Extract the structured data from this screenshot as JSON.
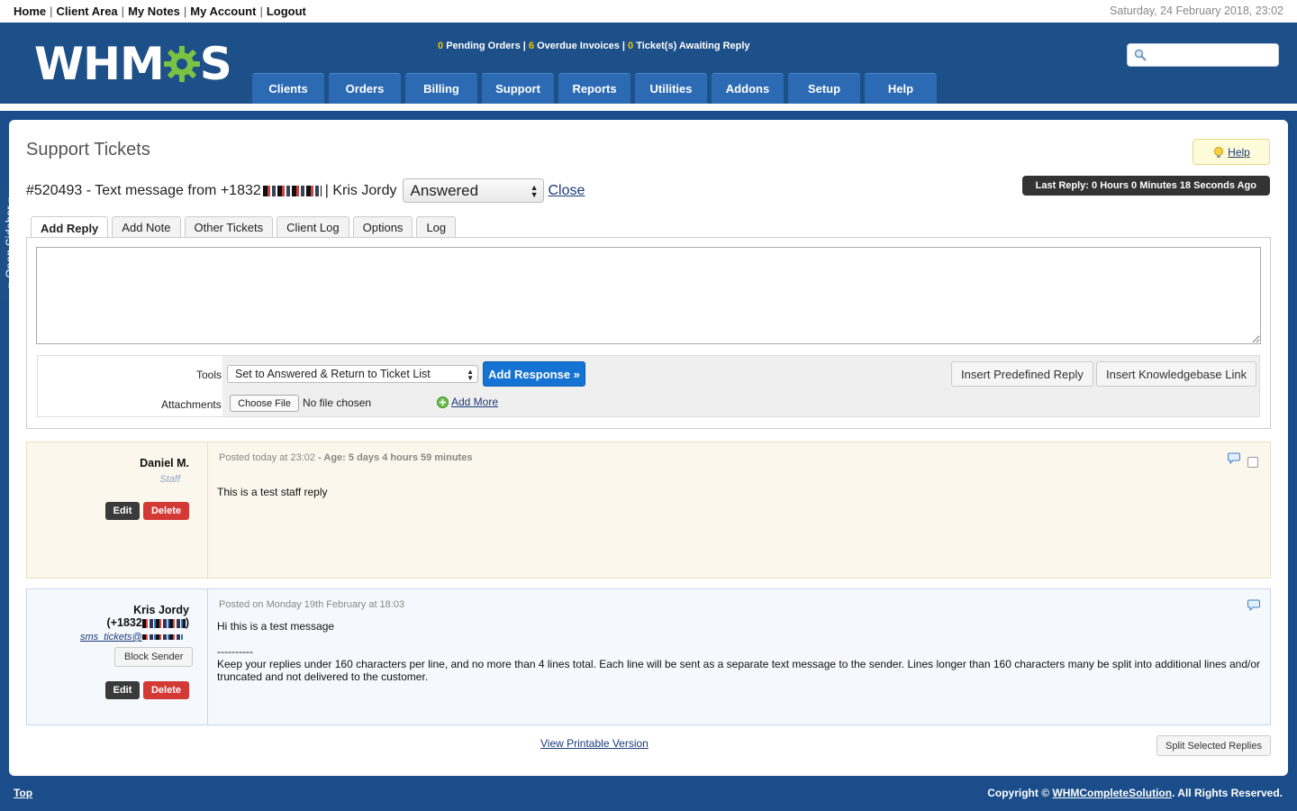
{
  "topnav": {
    "home": "Home",
    "client_area": "Client Area",
    "my_notes": "My Notes",
    "my_account": "My Account",
    "logout": "Logout",
    "separator": "|",
    "datetime": "Saturday, 24 February 2018, 23:02"
  },
  "logo": {
    "left": "WHM",
    "right": "S"
  },
  "stats": {
    "pending_orders_count": "0",
    "pending_orders_label": "Pending Orders",
    "overdue_invoices_count": "6",
    "overdue_invoices_label": "Overdue Invoices",
    "awaiting_count": "0",
    "awaiting_label": "Ticket(s) Awaiting Reply",
    "separator": "|"
  },
  "search": {
    "placeholder": ""
  },
  "mainnav": [
    "Clients",
    "Orders",
    "Billing",
    "Support",
    "Reports",
    "Utilities",
    "Addons",
    "Setup",
    "Help"
  ],
  "sidebar_toggle": "» Open Sidebar »",
  "page": {
    "title": "Support Tickets",
    "help": "Help",
    "ticket_title": "#520493 - Text message from +1832",
    "ticket_client": "| Kris Jordy",
    "status": "Answered",
    "close": "Close",
    "last_reply": "Last Reply: 0 Hours 0 Minutes 18 Seconds Ago"
  },
  "tabs": [
    "Add Reply",
    "Add Note",
    "Other Tickets",
    "Client Log",
    "Options",
    "Log"
  ],
  "reply_form": {
    "tools_label": "Tools",
    "tools_selected": "Set to Answered & Return to Ticket List",
    "add_response": "Add Response »",
    "insert_predefined": "Insert Predefined Reply",
    "insert_kb": "Insert Knowledgebase Link",
    "attachments_label": "Attachments",
    "choose_file": "Choose File",
    "no_file": "No file chosen",
    "add_more": "Add More"
  },
  "replies": [
    {
      "name": "Daniel M.",
      "role": "Staff",
      "edit": "Edit",
      "delete": "Delete",
      "meta_posted": "Posted today at 23:02",
      "meta_age": " - Age: 5 days 4 hours 59 minutes",
      "message": "This is a test staff reply"
    },
    {
      "name": "Kris Jordy",
      "phone_prefix": "(+1832",
      "phone_suffix": ")",
      "email_prefix": "sms_tickets@",
      "block_sender": "Block Sender",
      "edit": "Edit",
      "delete": "Delete",
      "meta_posted": "Posted on Monday 19th February at 18:03",
      "message_line1": "Hi this is a test message",
      "message_divider": "----------",
      "message_line2": "Keep your replies under 160 characters per line, and no more than 4 lines total. Each line will be sent as a separate text message to the sender. Lines longer than 160 characters many be split into additional lines and/or",
      "message_line3": "truncated and not delivered to the customer."
    }
  ],
  "footer_actions": {
    "printable": "View Printable Version",
    "split": "Split Selected Replies"
  },
  "footer": {
    "top": "Top",
    "copyright_prefix": "Copyright ©",
    "copyright_link": "WHMCompleteSolution",
    "copyright_suffix": ". All Rights Reserved."
  },
  "colors": {
    "brand_blue": "#1d5089",
    "nav_tab": "#2c6ab3",
    "primary_button": "#1573d4",
    "danger": "#d33a36",
    "stat_highlight": "#f3c200"
  }
}
